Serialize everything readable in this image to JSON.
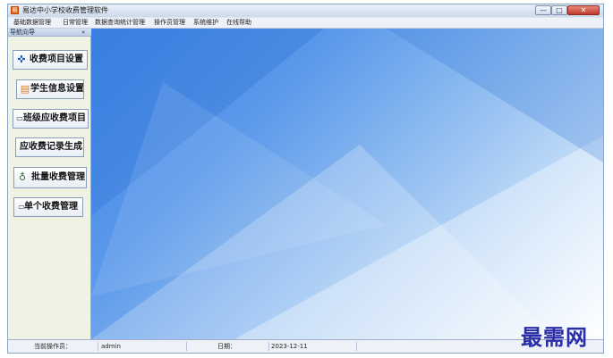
{
  "window": {
    "title": "易达中小学校收费管理软件",
    "icon_text": "易"
  },
  "window_controls": {
    "minimize": "—",
    "maximize": "□",
    "close": "✕"
  },
  "menu": [
    "基础数据管理",
    "日常管理",
    "数据查询统计管理",
    "操作员管理",
    "系统维护",
    "在线帮助"
  ],
  "sidebar": {
    "header": "导航向导",
    "collapse_glyph": "«",
    "buttons": [
      {
        "label": "收费项目设置",
        "icon": "gear-arrows-icon",
        "glyph": "✜"
      },
      {
        "label": "学生信息设置",
        "icon": "student-info-icon",
        "glyph": "▤"
      },
      {
        "label": "班级应收费项目",
        "icon": "class-fee-icon",
        "glyph": "▭"
      },
      {
        "label": "应收费记录生成",
        "icon": "",
        "glyph": ""
      },
      {
        "label": "批量收费管理",
        "icon": "money-bag-icon",
        "glyph": "♁"
      },
      {
        "label": "单个收费管理",
        "icon": "single-fee-icon",
        "glyph": "▭"
      }
    ]
  },
  "status": {
    "operator_label": "当前操作员：",
    "operator_value": "admin",
    "date_label": "日期：",
    "date_value": "2023-12-11"
  },
  "watermark": "最需网",
  "colors": {
    "desktop_blue": "#3f86e6",
    "sidebar_bg": "#eef3e3",
    "watermark": "#2a2da8"
  }
}
